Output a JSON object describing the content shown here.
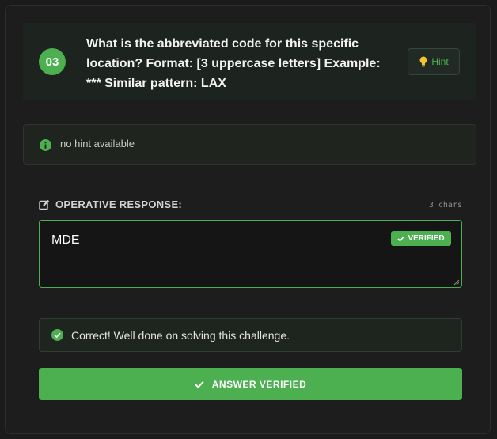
{
  "question": {
    "number": "03",
    "text": "What is the abbreviated code for this specific location? Format: [3 uppercase letters] Example: *** Similar pattern: LAX",
    "hint_label": "Hint"
  },
  "hint_box": {
    "text": "no hint available"
  },
  "response": {
    "label": "OPERATIVE RESPONSE:",
    "char_count": "3 chars",
    "value": "MDE",
    "status_badge": "VERIFIED"
  },
  "feedback": {
    "text": "Correct! Well done on solving this challenge."
  },
  "submit": {
    "label": "ANSWER VERIFIED"
  },
  "colors": {
    "accent": "#4caf50",
    "background": "#1b1b1b"
  },
  "icons": {
    "hint": "lightbulb-icon",
    "info": "info-icon",
    "edit": "edit-icon",
    "verified": "check-icon",
    "success": "check-circle-icon",
    "submit": "check-icon"
  }
}
